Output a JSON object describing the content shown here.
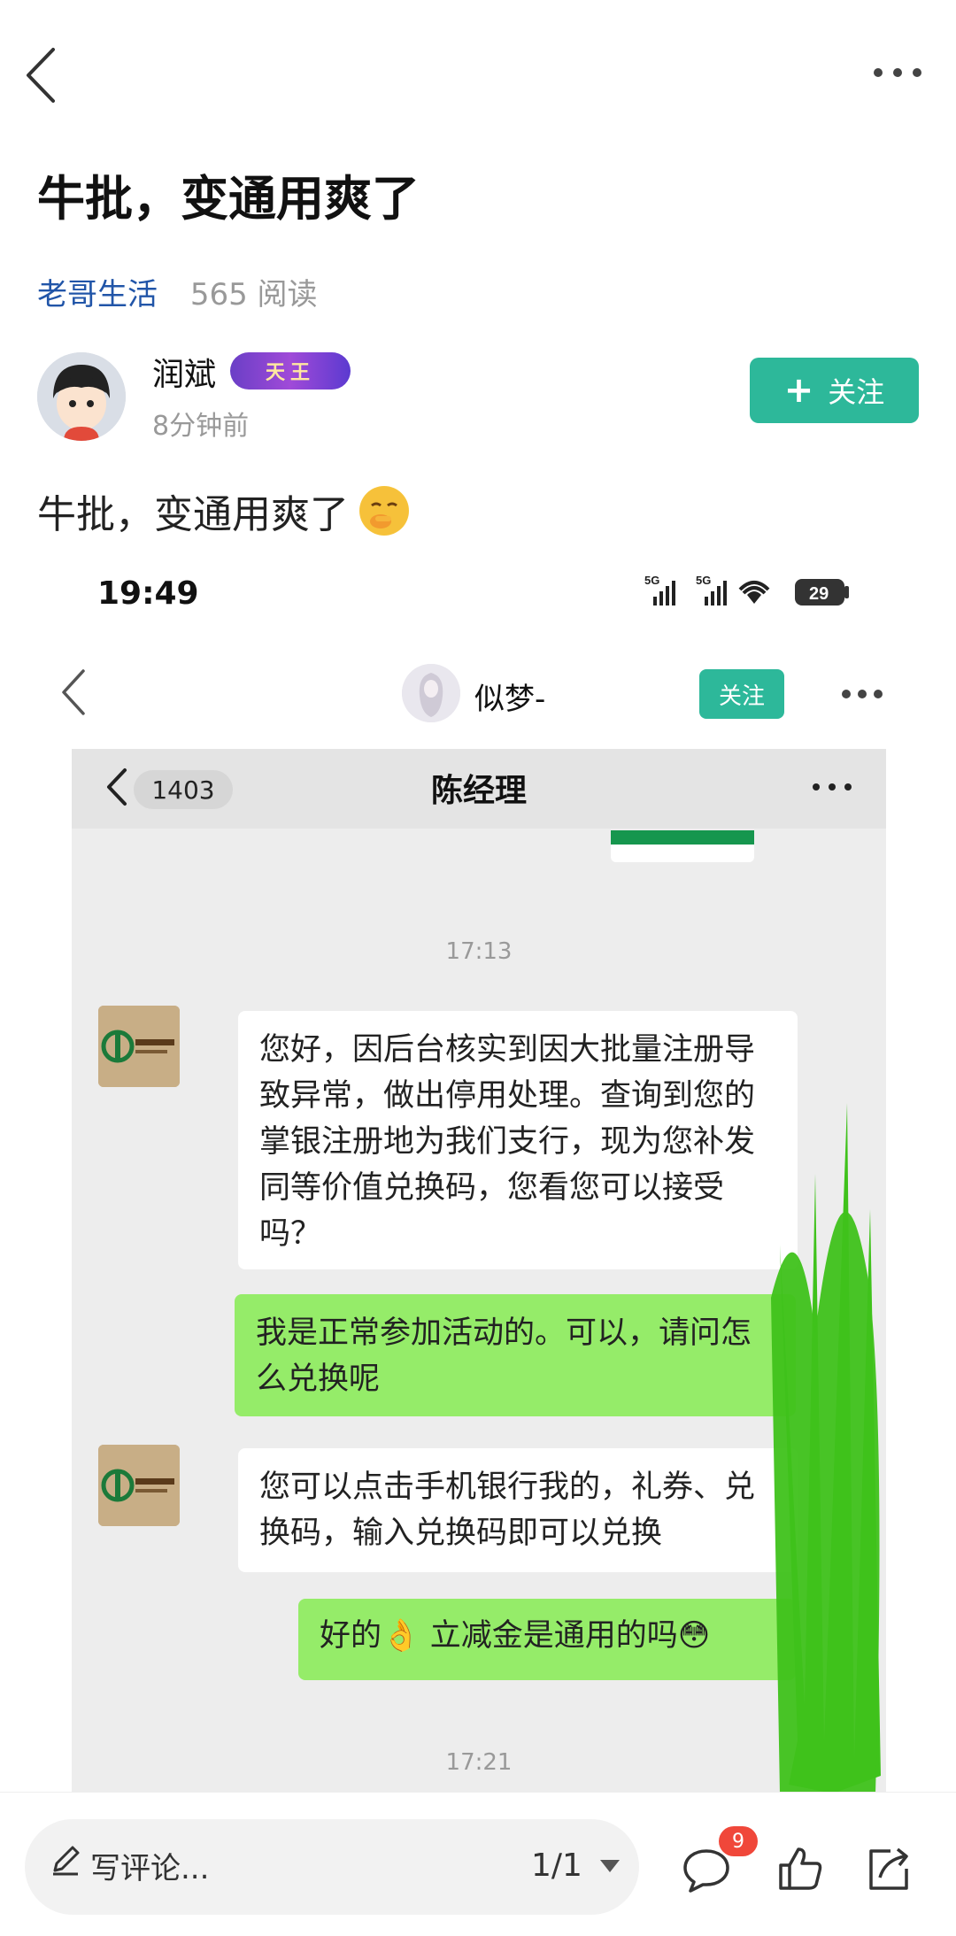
{
  "header": {
    "title": "牛批，变通用爽了"
  },
  "meta": {
    "channel": "老哥生活",
    "reads": "565 阅读"
  },
  "author": {
    "name": "润斌",
    "badge": "天王",
    "time": "8分钟前",
    "follow_label": "关注"
  },
  "post": {
    "text": "牛批，变通用爽了"
  },
  "screenshot": {
    "status_time": "19:49",
    "battery": "29",
    "profile_name": "似梦-",
    "profile_follow": "关注",
    "chat": {
      "unread": "1403",
      "title": "陈经理",
      "messages": [
        {
          "type": "time",
          "text": "17:13"
        },
        {
          "type": "in",
          "text": "您好，因后台核实到因大批量注册导致异常，做出停用处理。查询到您的掌银注册地为我们支行，现为您补发同等价值兑换码，您看您可以接受吗？"
        },
        {
          "type": "out",
          "text": "我是正常参加活动的。可以，请问怎么兑换呢"
        },
        {
          "type": "in",
          "text": "您可以点击手机银行我的，礼券、兑换码，输入兑换码即可以兑换"
        },
        {
          "type": "out",
          "text": "好的👌 立减金是通用的吗😳"
        },
        {
          "type": "time",
          "text": "17:21"
        }
      ]
    }
  },
  "bottom_bar": {
    "comment_placeholder": "写评论...",
    "page_indicator": "1/1",
    "comment_count": "9"
  },
  "colors": {
    "accent": "#2db89a",
    "link": "#2155a8",
    "bubble_out": "#95ec69",
    "badge_red": "#f0473a"
  }
}
